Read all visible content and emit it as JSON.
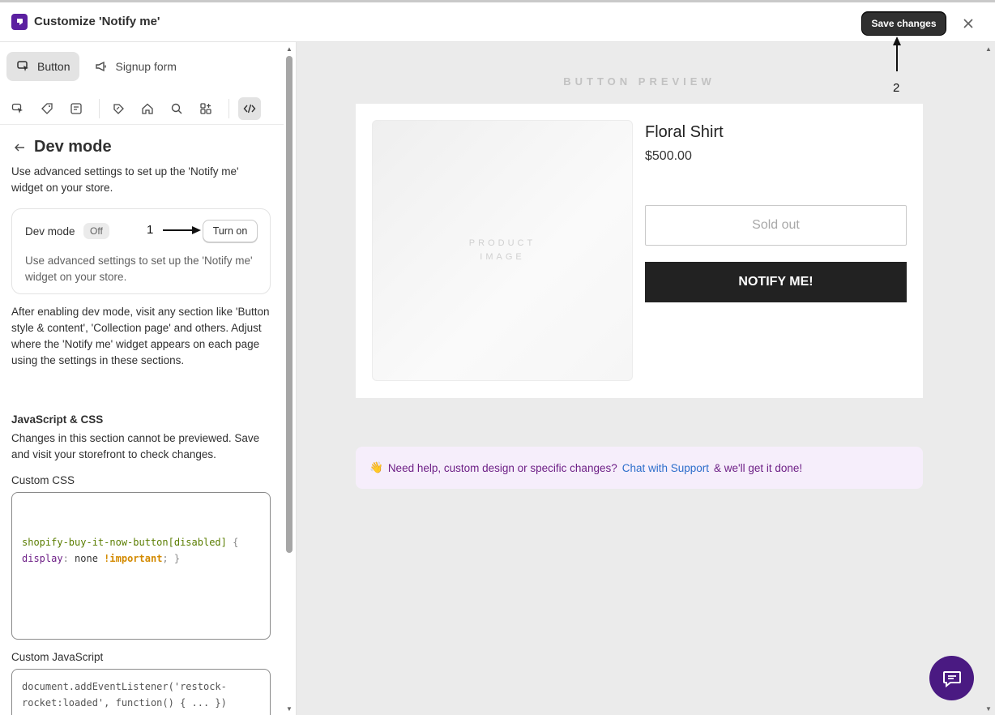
{
  "header": {
    "title": "Customize 'Notify me'",
    "save_label": "Save changes",
    "annotation_save": "2"
  },
  "sidebar": {
    "tabs": [
      {
        "label": "Button",
        "icon": "cursor-click-icon",
        "active": true
      },
      {
        "label": "Signup form",
        "icon": "megaphone-icon",
        "active": false
      }
    ],
    "icon_bar": [
      "cursor-click-icon",
      "tag-icon",
      "note-icon",
      "price-tag-icon",
      "home-icon",
      "search-icon",
      "apps-icon",
      "code-icon"
    ],
    "section_title": "Dev mode",
    "intro": "Use advanced settings to set up the 'Notify me' widget on your store.",
    "dev_card": {
      "label": "Dev mode",
      "status": "Off",
      "annotation": "1",
      "button_label": "Turn on",
      "description": "Use advanced settings to set up the 'Notify me' widget on your store."
    },
    "after_text": "After enabling dev mode, visit any section like 'Button style & content', 'Collection page' and others. Adjust where the 'Notify me' widget appears on each page using the settings in these sections.",
    "js_css_heading": "JavaScript & CSS",
    "js_css_desc": "Changes in this section cannot be previewed. Save and visit your storefront to check changes.",
    "custom_css_label": "Custom CSS",
    "css_selector": "shopify-buy-it-now-button[disabled]",
    "css_open": " {",
    "css_prop": "display",
    "css_colon": ":",
    "css_value": " none ",
    "css_important": "!important",
    "css_close": "; }",
    "custom_js_label": "Custom JavaScript",
    "js_line1": "document.addEventListener('restock-",
    "js_line2": "rocket:loaded', function() { ... })"
  },
  "preview": {
    "label": "BUTTON PREVIEW",
    "image_label": "PRODUCT IMAGE",
    "product_name": "Floral Shirt",
    "price": "$500.00",
    "sold_out_label": "Sold out",
    "notify_label": "NOTIFY ME!"
  },
  "help": {
    "emoji": "👋",
    "text": "Need help, custom design or specific changes?",
    "link": "Chat with Support",
    "suffix": "& we'll get it done!"
  },
  "colors": {
    "brand": "#5b1fa0",
    "primary_button": "#303030",
    "notify_button": "#222222",
    "link": "#2c6ecb",
    "help_text": "#6d1f86"
  }
}
